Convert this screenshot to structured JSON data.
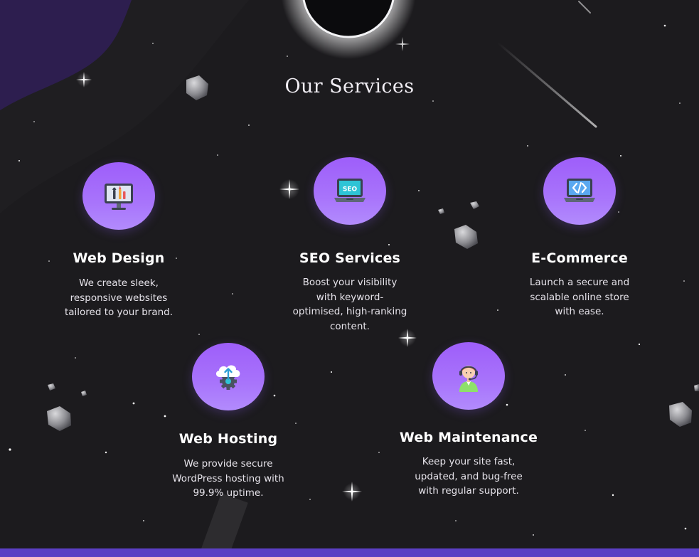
{
  "section": {
    "title": "Our Services"
  },
  "services": [
    {
      "name": "Web Design",
      "icon": "monitor-paintbrush-icon",
      "lines": [
        "We create sleek,",
        "responsive websites",
        "tailored to your brand."
      ]
    },
    {
      "name": "SEO Services",
      "icon": "seo-laptop-icon",
      "lines": [
        "Boost your visibility",
        "with keyword-",
        "optimised, high-ranking",
        "content."
      ]
    },
    {
      "name": "E-Commerce",
      "icon": "code-laptop-icon",
      "lines": [
        "Launch a secure and",
        "scalable online store",
        "with ease."
      ]
    },
    {
      "name": "Web Hosting",
      "icon": "cloud-upload-gear-icon",
      "lines": [
        "We provide secure",
        "WordPress hosting with",
        "99.9% uptime."
      ]
    },
    {
      "name": "Web Maintenance",
      "icon": "support-agent-headset-icon",
      "lines": [
        "Keep your site fast,",
        "updated, and bug-free",
        "with regular support."
      ]
    }
  ],
  "colors": {
    "background": "#1c1b1e",
    "circle_gradient_top": "#9e5efa",
    "circle_gradient_bottom": "#b28bfd",
    "bottom_bar": "#5b3fc4",
    "nebula": "#2a1b4d"
  }
}
